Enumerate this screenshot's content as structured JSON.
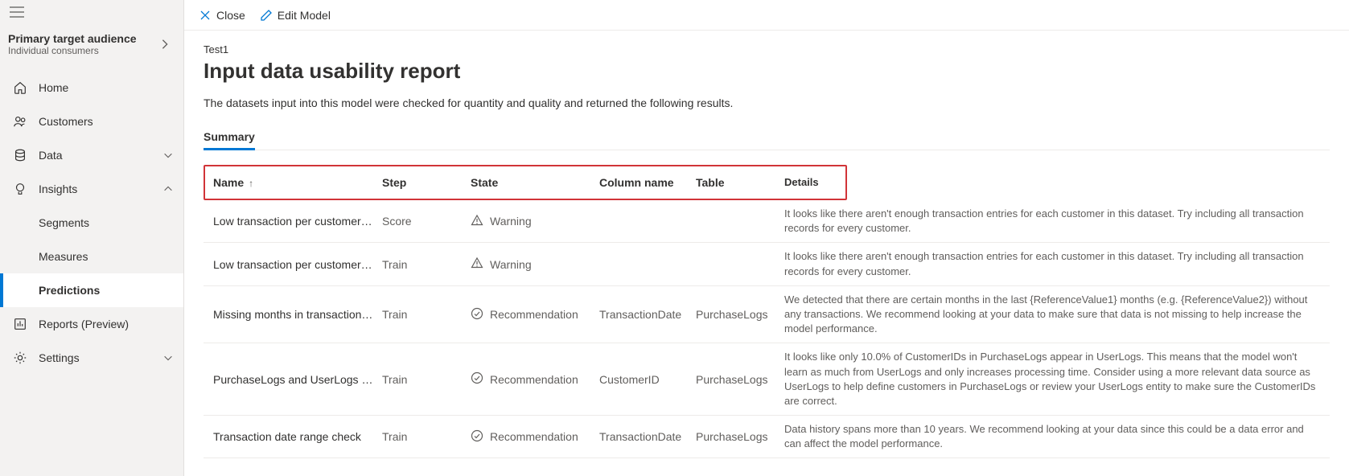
{
  "audience": {
    "title": "Primary target audience",
    "subtitle": "Individual consumers"
  },
  "nav": {
    "home": "Home",
    "customers": "Customers",
    "data": "Data",
    "insights": "Insights",
    "segments": "Segments",
    "measures": "Measures",
    "predictions": "Predictions",
    "reports": "Reports (Preview)",
    "settings": "Settings"
  },
  "toolbar": {
    "close": "Close",
    "edit": "Edit Model"
  },
  "breadcrumb": "Test1",
  "page_title": "Input data usability report",
  "page_desc": "The datasets input into this model were checked for quantity and quality and returned the following results.",
  "tabs": {
    "summary": "Summary"
  },
  "columns": {
    "name": "Name",
    "step": "Step",
    "state": "State",
    "column_name": "Column name",
    "table": "Table",
    "details": "Details"
  },
  "rows": [
    {
      "name": "Low transaction per customer (s...",
      "step": "Score",
      "state": "Warning",
      "state_icon": "warning",
      "column_name": "",
      "table": "",
      "details": "It looks like there aren't enough transaction entries for each customer in this dataset. Try including all transaction records for every customer."
    },
    {
      "name": "Low transaction per customer (s...",
      "step": "Train",
      "state": "Warning",
      "state_icon": "warning",
      "column_name": "",
      "table": "",
      "details": "It looks like there aren't enough transaction entries for each customer in this dataset. Try including all transaction records for every customer."
    },
    {
      "name": "Missing months in transactions ...",
      "step": "Train",
      "state": "Recommendation",
      "state_icon": "recommend",
      "column_name": "TransactionDate",
      "table": "PurchaseLogs",
      "details": "We detected that there are certain months in the last {ReferenceValue1} months (e.g. {ReferenceValue2}) without any transactions. We recommend looking at your data to make sure that data is not missing to help increase the model performance."
    },
    {
      "name": "PurchaseLogs and UserLogs cus...",
      "step": "Train",
      "state": "Recommendation",
      "state_icon": "recommend",
      "column_name": "CustomerID",
      "table": "PurchaseLogs",
      "details": "It looks like only 10.0% of CustomerIDs in PurchaseLogs appear in UserLogs. This means that the model won't learn as much from UserLogs and only increases processing time. Consider using a more relevant data source as UserLogs to help define customers in PurchaseLogs or review your UserLogs entity to make sure the CustomerIDs are correct."
    },
    {
      "name": "Transaction date range check",
      "step": "Train",
      "state": "Recommendation",
      "state_icon": "recommend",
      "column_name": "TransactionDate",
      "table": "PurchaseLogs",
      "details": "Data history spans more than 10 years. We recommend looking at your data since this could be a data error and can affect the model performance."
    }
  ]
}
